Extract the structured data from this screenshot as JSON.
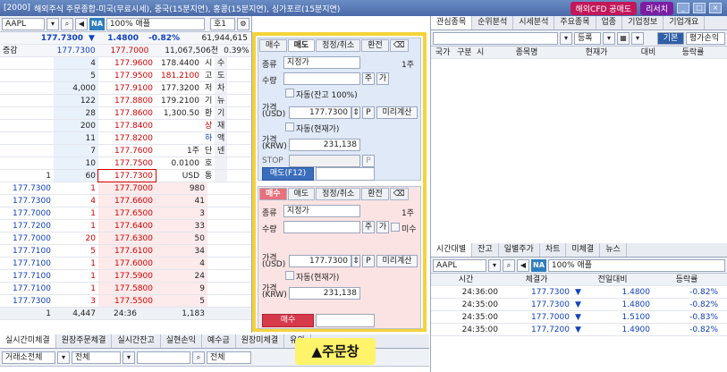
{
  "title": {
    "screen_no": "[2000]",
    "text": "해외주식 주문종합-미국(무료시세), 중국(15분지연), 홍콩(15분지연), 싱가포르(15분지연)",
    "cfd_btn": "해외CFD 공매도",
    "research_btn": "리서치"
  },
  "left_toolbar": {
    "symbol": "AAPL",
    "na": "NA",
    "name": "100% 애플",
    "tick": "호1"
  },
  "summary": {
    "price": "177.7300",
    "arrow": "▼",
    "change": "1.4800",
    "pct": "-0.82%",
    "volume": "61,944,615",
    "label": "증감",
    "ask_total": "177.7300",
    "bid_total": "177.7000",
    "amount": "11,067,506천",
    "ratio": "0.39%"
  },
  "ask_rows": [
    {
      "qty": "4",
      "price": "177.9600"
    },
    {
      "qty": "5",
      "price": "177.9500"
    },
    {
      "qty": "4,000",
      "price": "177.9100"
    },
    {
      "qty": "122",
      "price": "177.8800"
    },
    {
      "qty": "28",
      "price": "177.8600"
    },
    {
      "qty": "200",
      "price": "177.8400"
    },
    {
      "qty": "11",
      "price": "177.8200"
    },
    {
      "qty": "7",
      "price": "177.7600"
    },
    {
      "qty": "10",
      "price": "177.7500"
    },
    {
      "qty": "60",
      "price": "177.7300"
    }
  ],
  "ask_change": "1",
  "info_rows": [
    {
      "val": "178.4400",
      "lab": "시"
    },
    {
      "val": "181.2100",
      "lab": "고"
    },
    {
      "val": "177.3200",
      "lab": "저"
    },
    {
      "val": "179.2100",
      "lab": "기"
    },
    {
      "val": "1,300.50",
      "lab": "환"
    },
    {
      "val": "",
      "lab": "상"
    },
    {
      "val": "",
      "lab": "하"
    },
    {
      "val": "1주",
      "lab": "단"
    },
    {
      "val": "0.0100",
      "lab": "호"
    },
    {
      "val": "USD",
      "lab": "통"
    }
  ],
  "side_labels": [
    "수",
    "도",
    "차",
    "뉴",
    "기",
    "재",
    "액",
    "넨"
  ],
  "bid_rows": [
    {
      "tprice": "177.7300",
      "tqty": "1",
      "price": "177.7000",
      "qty": "980"
    },
    {
      "tprice": "177.7300",
      "tqty": "4",
      "price": "177.6600",
      "qty": "41"
    },
    {
      "tprice": "177.7000",
      "tqty": "1",
      "price": "177.6500",
      "qty": "3"
    },
    {
      "tprice": "177.7200",
      "tqty": "1",
      "price": "177.6400",
      "qty": "33"
    },
    {
      "tprice": "177.7000",
      "tqty": "20",
      "price": "177.6300",
      "qty": "50"
    },
    {
      "tprice": "177.7100",
      "tqty": "5",
      "price": "177.6100",
      "qty": "34"
    },
    {
      "tprice": "177.7100",
      "tqty": "1",
      "price": "177.6000",
      "qty": "4"
    },
    {
      "tprice": "177.7100",
      "tqty": "1",
      "price": "177.5900",
      "qty": "24"
    },
    {
      "tprice": "177.7100",
      "tqty": "1",
      "price": "177.5800",
      "qty": "9"
    },
    {
      "tprice": "177.7300",
      "tqty": "3",
      "price": "177.5500",
      "qty": "5"
    }
  ],
  "totals": {
    "a": "1",
    "b": "4,447",
    "time": "24:36",
    "c": "1,183"
  },
  "bottom_tabs": [
    "실시간미체결",
    "원장주문체결",
    "실시간잔고",
    "실현손익",
    "예수금",
    "원장미체결",
    "유의"
  ],
  "bottom_filters": {
    "f1": "거래소전체",
    "f2": "전체",
    "f3": "전체"
  },
  "order": {
    "sell": {
      "tab_buy": "매수",
      "tab_sell": "매도",
      "tab_mod": "정정/취소",
      "tab_fx": "환전",
      "lbl_type": "종류",
      "type": "지정가",
      "unit": "1주",
      "lbl_qty": "수량",
      "btn_ju": "주",
      "btn_ga": "가",
      "auto1": "자동(잔고 100%)",
      "lbl_price": "가격",
      "lbl_usd": "(USD)",
      "price": "177.7300",
      "btn_p": "P",
      "btn_calc": "미리계산",
      "auto2": "자동(현재가)",
      "lbl_price2": "가격",
      "lbl_krw": "(KRW)",
      "krw": "231,138",
      "lbl_stop": "STOP",
      "submit": "매도(F12)"
    },
    "buy": {
      "tab_buy": "매수",
      "tab_sell": "매도",
      "tab_mod": "정정/취소",
      "tab_fx": "환전",
      "lbl_type": "종류",
      "type": "지정가",
      "unit": "1주",
      "lbl_qty": "수량",
      "btn_ju": "주",
      "btn_ga": "가",
      "mi": "미수",
      "lbl_price": "가격",
      "lbl_usd": "(USD)",
      "price": "177.7300",
      "btn_calc": "미리계산",
      "auto2": "자동(현재가)",
      "lbl_price2": "가격",
      "lbl_krw": "(KRW)",
      "krw": "231,138",
      "submit": "매수"
    }
  },
  "callout": "▲주문창",
  "right_panel": {
    "tabs": [
      "관심종목",
      "순위분석",
      "시세분석",
      "주요종목",
      "업종",
      "기업정보",
      "기업개요"
    ],
    "reg_btn": "등록",
    "basic_btn": "기본",
    "eval_btn": "평가손익",
    "headers": [
      "국가",
      "구분",
      "시",
      "종목명",
      "현재가",
      "대비",
      "등락률"
    ],
    "bottom_tabs": [
      "시간대별",
      "잔고",
      "일별주가",
      "차트",
      "미체결",
      "뉴스"
    ],
    "symbol": "AAPL",
    "na": "NA",
    "name": "100% 애플",
    "trade_headers": [
      "시간",
      "체결가",
      "전일대비",
      "등락률"
    ],
    "trades": [
      {
        "time": "24:36:00",
        "price": "177.7300",
        "change": "1.4800",
        "pct": "-0.82%"
      },
      {
        "time": "24:35:00",
        "price": "177.7300",
        "change": "1.4800",
        "pct": "-0.82%"
      },
      {
        "time": "24:35:00",
        "price": "177.7000",
        "change": "1.5100",
        "pct": "-0.83%"
      },
      {
        "time": "24:35:00",
        "price": "177.7200",
        "change": "1.4900",
        "pct": "-0.82%"
      }
    ]
  },
  "colors": {
    "accent": "#f4d33a",
    "up": "#d40000",
    "down": "#1040c0"
  }
}
